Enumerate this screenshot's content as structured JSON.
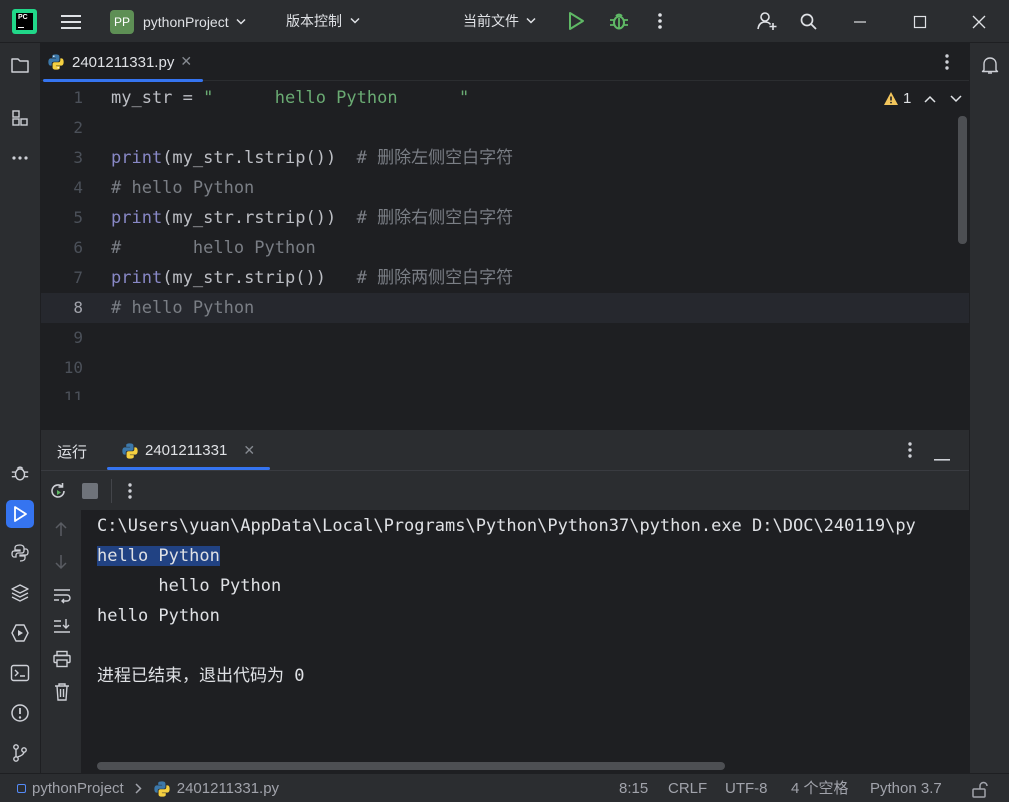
{
  "titlebar": {
    "project_badge": "PP",
    "project_name": "pythonProject",
    "vcs_label": "版本控制",
    "run_config": "当前文件"
  },
  "editor": {
    "tab_file": "2401211331.py",
    "warning_count": "1",
    "lines": [
      {
        "num": "1",
        "tokens": [
          {
            "t": "my_str = ",
            "c": "plain"
          },
          {
            "t": "\"      hello Python      \"",
            "c": "str"
          }
        ]
      },
      {
        "num": "2",
        "tokens": []
      },
      {
        "num": "3",
        "tokens": [
          {
            "t": "print",
            "c": "kw"
          },
          {
            "t": "(my_str.lstrip())  ",
            "c": "plain"
          },
          {
            "t": "# 删除左侧空白字符",
            "c": "cmt"
          }
        ]
      },
      {
        "num": "4",
        "tokens": [
          {
            "t": "# hello Python",
            "c": "cmt"
          }
        ]
      },
      {
        "num": "5",
        "tokens": [
          {
            "t": "print",
            "c": "kw"
          },
          {
            "t": "(my_str.rstrip())  ",
            "c": "plain"
          },
          {
            "t": "# 删除右侧空白字符",
            "c": "cmt"
          }
        ]
      },
      {
        "num": "6",
        "tokens": [
          {
            "t": "#       hello Python",
            "c": "cmt"
          }
        ]
      },
      {
        "num": "7",
        "tokens": [
          {
            "t": "print",
            "c": "kw"
          },
          {
            "t": "(my_str.strip())   ",
            "c": "plain"
          },
          {
            "t": "# 删除两侧空白字符",
            "c": "cmt"
          }
        ]
      },
      {
        "num": "8",
        "tokens": [
          {
            "t": "# hello Python",
            "c": "cmt"
          }
        ],
        "current": true
      },
      {
        "num": "9",
        "tokens": []
      },
      {
        "num": "10",
        "tokens": []
      },
      {
        "num": "11",
        "tokens": []
      }
    ]
  },
  "run": {
    "panel_label": "运行",
    "tab_name": "2401211331",
    "console_lines": [
      {
        "text": "C:\\Users\\yuan\\AppData\\Local\\Programs\\Python\\Python37\\python.exe D:\\DOC\\240119\\py"
      },
      {
        "text": "hello Python",
        "selected": true
      },
      {
        "text": "      hello Python"
      },
      {
        "text": "hello Python"
      },
      {
        "text": ""
      },
      {
        "text": "进程已结束，退出代码为 0"
      }
    ]
  },
  "statusbar": {
    "project": "pythonProject",
    "file": "2401211331.py",
    "position": "8:15",
    "line_sep": "CRLF",
    "encoding": "UTF-8",
    "indent": "4 个空格",
    "interpreter": "Python 3.7"
  },
  "colors": {
    "accent": "#3574f0",
    "run_green": "#5fb865",
    "string": "#6aab73",
    "keyword": "#8888c6",
    "comment": "#7a7e85",
    "warning": "#f2c55c",
    "selection": "#214283"
  }
}
